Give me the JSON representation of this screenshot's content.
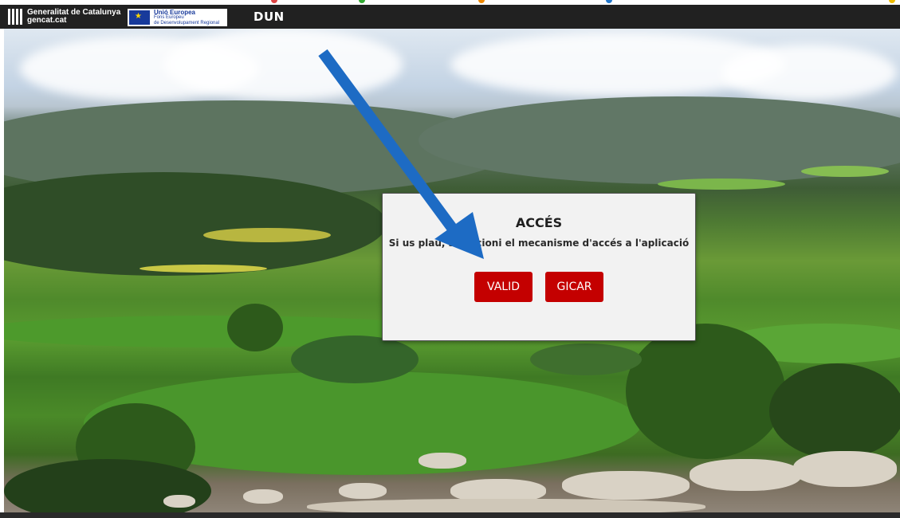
{
  "header": {
    "brand_line1": "Generalitat de Catalunya",
    "brand_line2": "gencat.cat",
    "eu_title": "Unió Europea",
    "eu_line1": "Fons Europeu",
    "eu_line2": "de Desenvolupament Regional",
    "app_title": "DUN"
  },
  "modal": {
    "title": "ACCÉS",
    "message": "Si us plau, seleccioni el mecanisme d'accés a l'aplicació",
    "buttons": {
      "valid": "VALID",
      "gicar": "GICAR"
    }
  },
  "colors": {
    "header_bg": "#212121",
    "button_bg": "#c40000",
    "arrow": "#1d6bc4"
  }
}
